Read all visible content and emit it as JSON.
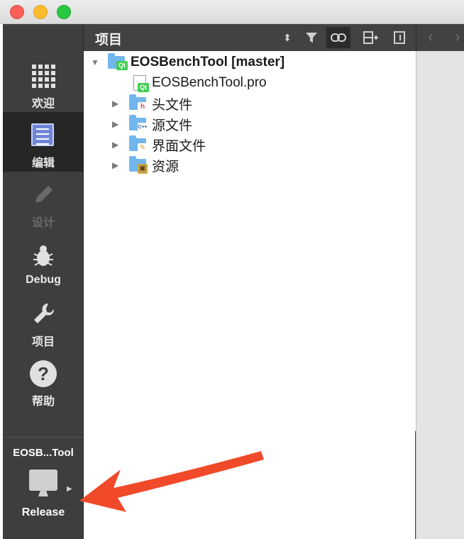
{
  "window": {
    "traffic_lights": [
      "close",
      "minimize",
      "zoom"
    ]
  },
  "modebar": {
    "modes": [
      {
        "label": "欢迎",
        "icon": "grid-icon"
      },
      {
        "label": "编辑",
        "icon": "edit-icon",
        "active": true
      },
      {
        "label": "设计",
        "icon": "pencil-icon",
        "disabled": true
      },
      {
        "label": "Debug",
        "icon": "bug-icon"
      },
      {
        "label": "项目",
        "icon": "wrench-icon"
      },
      {
        "label": "帮助",
        "icon": "help-icon"
      }
    ],
    "target_name": "EOSB...Tool",
    "build_config": "Release"
  },
  "pane": {
    "title": "项目"
  },
  "tree": {
    "root": "EOSBenchTool [master]",
    "pro_file": "EOSBenchTool.pro",
    "folders": [
      {
        "label": "头文件",
        "badge": "h"
      },
      {
        "label": "源文件",
        "badge": "C++"
      },
      {
        "label": "界面文件",
        "badge": "✎"
      },
      {
        "label": "资源",
        "badge": "lock"
      }
    ]
  },
  "colors": {
    "annotation_arrow": "#f04a2a",
    "sidebar": "#3e3e3e",
    "active_mode": "#262626"
  }
}
